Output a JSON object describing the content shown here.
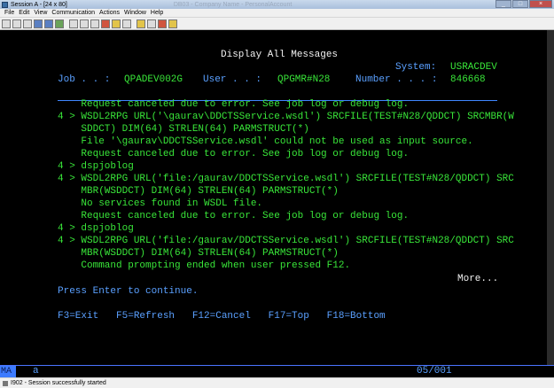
{
  "window": {
    "title": "Session A - [24 x 80]",
    "faded_title": "DB03 - Company Name - PersonalAccount"
  },
  "menu": [
    "File",
    "Edit",
    "View",
    "Communication",
    "Actions",
    "Window",
    "Help"
  ],
  "toolbar_icons": [
    "print-icon",
    "copy-icon",
    "paste-icon",
    "send-icon",
    "receive-icon",
    "display-icon",
    "color-icon",
    "keyboard-icon",
    "mouse-icon",
    "record-icon",
    "play-icon",
    "stop-icon",
    "map-icon",
    "support-icon",
    "index-icon",
    "help-icon"
  ],
  "terminal": {
    "heading": "Display All Messages",
    "system_label": "System:",
    "system_value": "USRACDEV",
    "job_label": "Job . . :",
    "job_value": "QPADEV002G",
    "user_label": "User . . :",
    "user_value": "QPGMR#N28",
    "number_label": "Number . . . :",
    "number_value": "846668",
    "messages": [
      "    Request canceled due to error. See job log or debug log.",
      "4 > WSDL2RPG URL('\\gaurav\\DDCTSService.wsdl') SRCFILE(TEST#N28/QDDCT) SRCMBR(W",
      "    SDDCT) DIM(64) STRLEN(64) PARMSTRUCT(*)",
      "    File '\\gaurav\\DDCTSService.wsdl' could not be used as input source.",
      "    Request canceled due to error. See job log or debug log.",
      "4 > dspjoblog",
      "4 > WSDL2RPG URL('file:/gaurav/DDCTSService.wsdl') SRCFILE(TEST#N28/QDDCT) SRC",
      "    MBR(WSDDCT) DIM(64) STRLEN(64) PARMSTRUCT(*)",
      "    No services found in WSDL file.",
      "    Request canceled due to error. See job log or debug log.",
      "4 > dspjoblog",
      "4 > WSDL2RPG URL('file:/gaurav/DDCTSService.wsdl') SRCFILE(TEST#N28/QDDCT) SRC",
      "    MBR(WSDDCT) DIM(64) STRLEN(64) PARMSTRUCT(*)",
      "    Command prompting ended when user pressed F12."
    ],
    "more": "More...",
    "press_enter": "Press Enter to continue.",
    "function_keys": "F3=Exit   F5=Refresh   F12=Cancel   F17=Top   F18=Bottom"
  },
  "oia": {
    "mode": "MA",
    "indicator": "a",
    "cursor_position": "05/001"
  },
  "statusbar": {
    "message": "I902 - Session successfully started"
  },
  "colors": {
    "screen_bg": "#000000",
    "green": "#39e639",
    "white": "#f2f2f2",
    "blue": "#5aa0ff"
  }
}
